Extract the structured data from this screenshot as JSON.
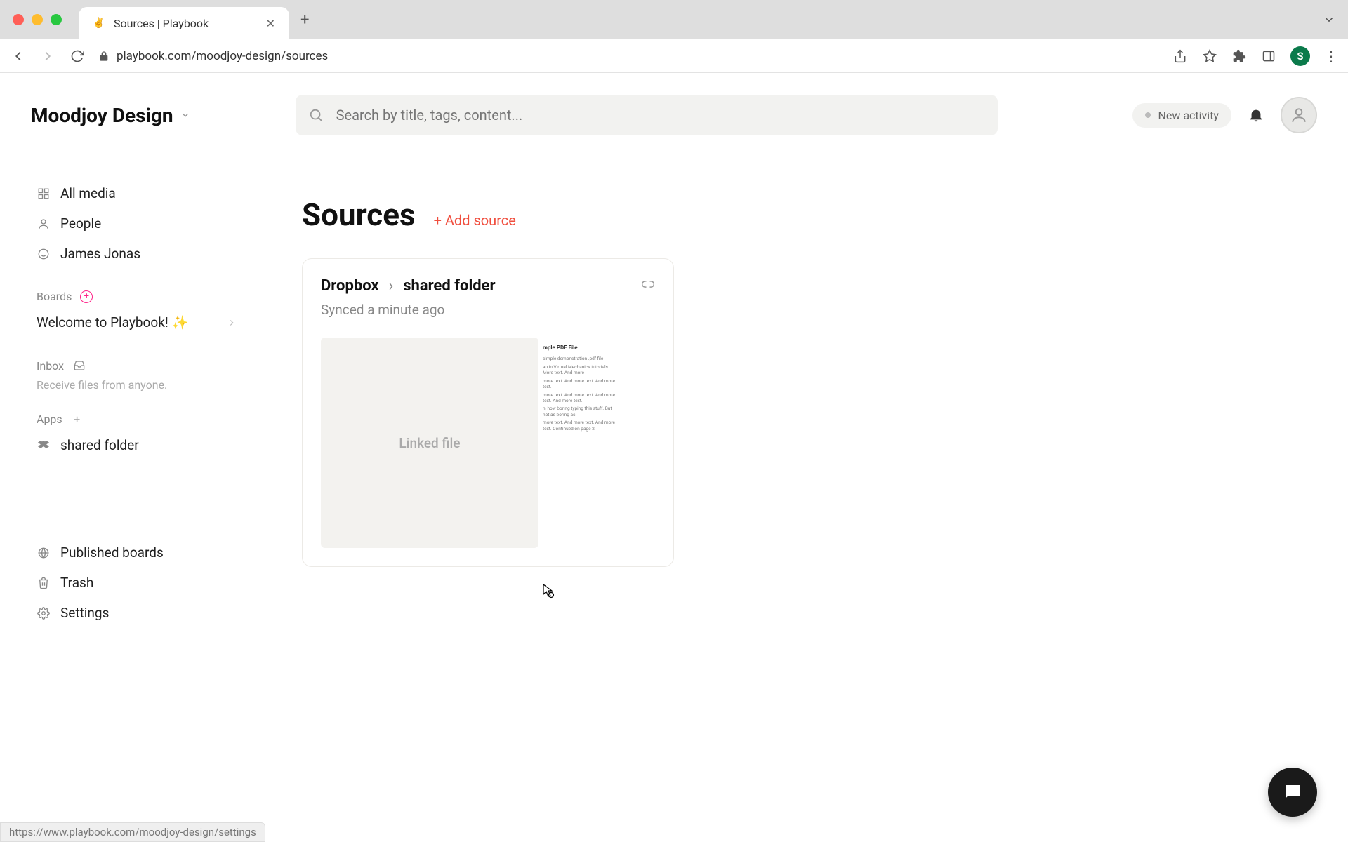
{
  "browser": {
    "tab_title": "Sources | Playbook",
    "url": "playbook.com/moodjoy-design/sources",
    "profile_initial": "S",
    "status_url": "https://www.playbook.com/moodjoy-design/settings"
  },
  "header": {
    "workspace": "Moodjoy Design",
    "search_placeholder": "Search by title, tags, content...",
    "new_activity": "New activity"
  },
  "sidebar": {
    "nav": {
      "all_media": "All media",
      "people": "People",
      "james": "James Jonas"
    },
    "boards": {
      "heading": "Boards",
      "welcome": "Welcome to Playbook! ✨"
    },
    "inbox": {
      "heading": "Inbox",
      "sub": "Receive files from anyone."
    },
    "apps": {
      "heading": "Apps",
      "shared_folder": "shared folder"
    },
    "bottom": {
      "published": "Published boards",
      "trash": "Trash",
      "settings": "Settings"
    }
  },
  "main": {
    "title": "Sources",
    "add_source": "+ Add source",
    "card": {
      "provider": "Dropbox",
      "sep": "›",
      "folder": "shared folder",
      "synced": "Synced a minute ago",
      "linked_label": "Linked file",
      "pdf_title": "mple PDF File",
      "pdf_line1": "simple demonstration .pdf file",
      "pdf_line2": "an in Virtual Mechanics tutorials. More text. And more",
      "pdf_line3": "more text. And more text. And more text.",
      "pdf_line4": "more text. And more text. And more text. And more text.",
      "pdf_line5": "n, how boring typing this stuff. But not as boring as ",
      "pdf_line6": "more text. And more text. And more text. Continued on page 2"
    }
  }
}
